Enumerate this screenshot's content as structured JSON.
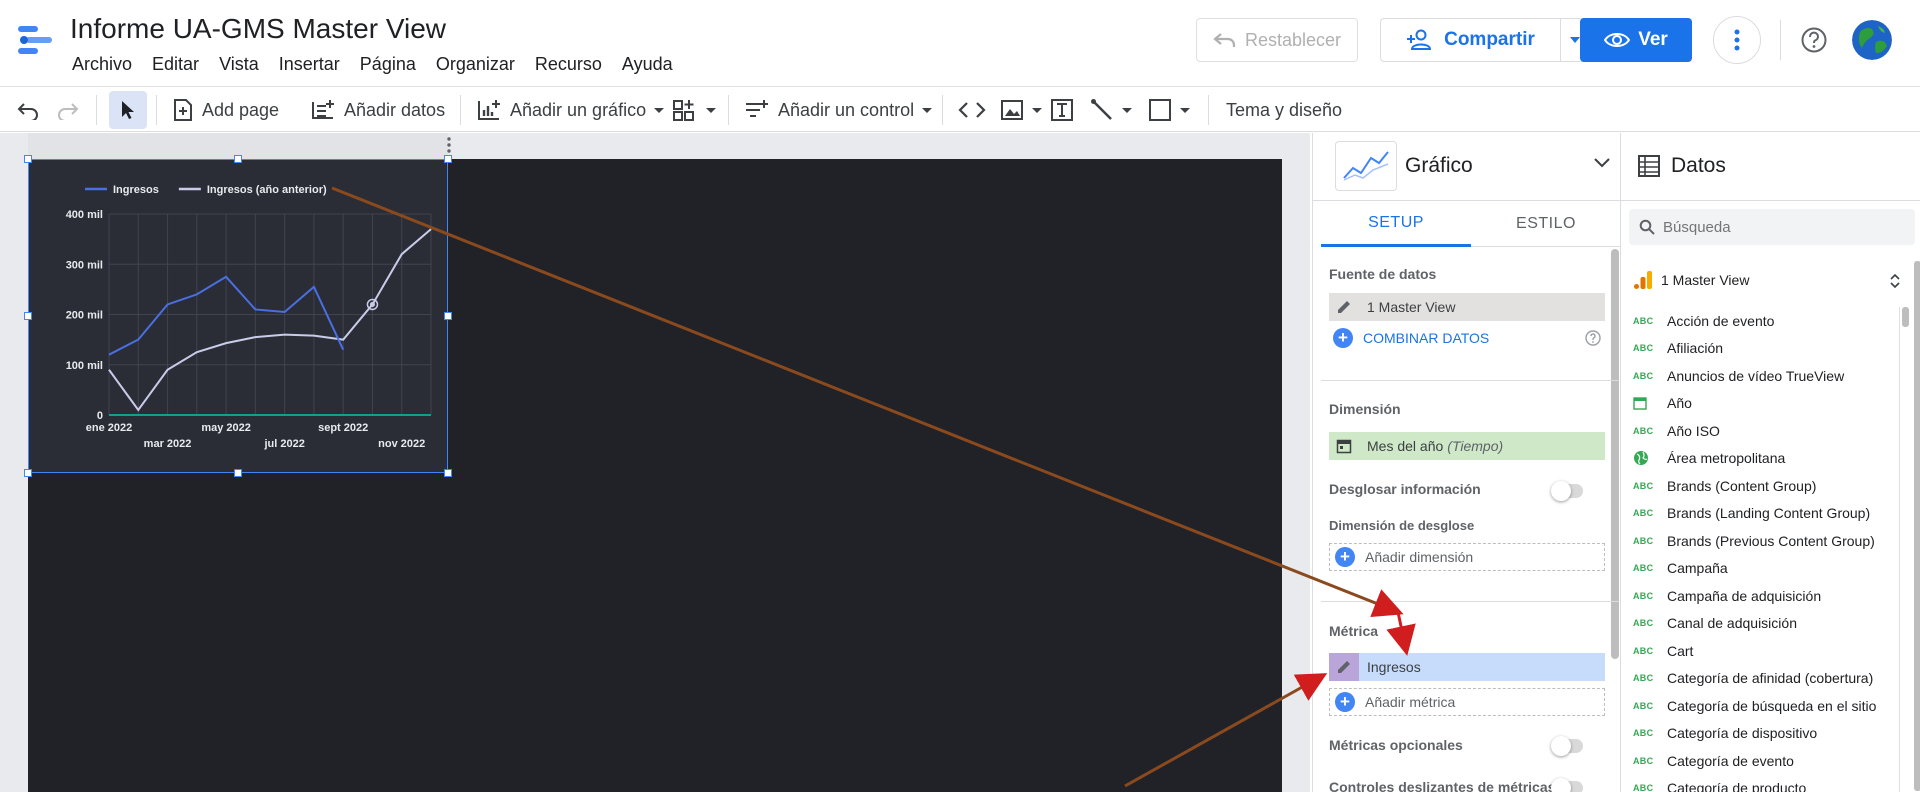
{
  "app": {
    "title": "Informe UA-GMS Master View",
    "menu": [
      "Archivo",
      "Editar",
      "Vista",
      "Insertar",
      "Página",
      "Organizar",
      "Recurso",
      "Ayuda"
    ],
    "reset_label": "Restablecer",
    "share_label": "Compartir",
    "view_label": "Ver"
  },
  "toolbar": {
    "add_page": "Add page",
    "add_data": "Añadir datos",
    "add_chart": "Añadir un gráfico",
    "add_control": "Añadir un control",
    "theme": "Tema y diseño"
  },
  "chart_data": {
    "type": "line",
    "series": [
      {
        "name": "Ingresos",
        "color": "#4a6fe3",
        "values": [
          120,
          150,
          220,
          240,
          275,
          210,
          205,
          255,
          130
        ]
      },
      {
        "name": "Ingresos (año anterior)",
        "color": "#c8cce8",
        "values": [
          90,
          10,
          90,
          125,
          143,
          155,
          160,
          158,
          150,
          220,
          320,
          370
        ]
      }
    ],
    "x_ticks_top": [
      "ene 2022",
      "may 2022",
      "sept 2022"
    ],
    "x_ticks_bottom": [
      "mar 2022",
      "jul 2022",
      "nov 2022"
    ],
    "y_ticks": [
      "0",
      "100 mil",
      "200 mil",
      "300 mil",
      "400 mil"
    ],
    "ylim": [
      0,
      400
    ]
  },
  "properties": {
    "chart_type": "Gráfico",
    "tabs": [
      "SETUP",
      "ESTILO"
    ],
    "data_source_label": "Fuente de datos",
    "data_source": "1 Master View",
    "blend_data": "COMBINAR DATOS",
    "dimension_label": "Dimensión",
    "dimension_field": "Mes del año",
    "dimension_type": "(Tiempo)",
    "drilldown_label": "Desglosar información",
    "breakdown_label": "Dimensión de desglose",
    "add_dimension": "Añadir dimensión",
    "metric_label": "Métrica",
    "metric_field": "Ingresos",
    "add_metric": "Añadir métrica",
    "optional_metrics_label": "Métricas opcionales",
    "metric_sliders_label": "Controles deslizantes de métricas"
  },
  "data_panel": {
    "title": "Datos",
    "search_placeholder": "Búsqueda",
    "source": "1 Master View",
    "fields": [
      {
        "name": "Acción de evento",
        "icon": "abc"
      },
      {
        "name": "Afiliación",
        "icon": "abc"
      },
      {
        "name": "Anuncios de vídeo TrueView",
        "icon": "abc"
      },
      {
        "name": "Año",
        "icon": "calendar"
      },
      {
        "name": "Año ISO",
        "icon": "abc"
      },
      {
        "name": "Área metropolitana",
        "icon": "globe"
      },
      {
        "name": "Brands (Content Group)",
        "icon": "abc"
      },
      {
        "name": "Brands (Landing Content Group)",
        "icon": "abc"
      },
      {
        "name": "Brands (Previous Content Group)",
        "icon": "abc"
      },
      {
        "name": "Campaña",
        "icon": "abc"
      },
      {
        "name": "Campaña de adquisición",
        "icon": "abc"
      },
      {
        "name": "Canal de adquisición",
        "icon": "abc"
      },
      {
        "name": "Cart",
        "icon": "abc"
      },
      {
        "name": "Categoría de afinidad (cobertura)",
        "icon": "abc"
      },
      {
        "name": "Categoría de búsqueda en el sitio",
        "icon": "abc"
      },
      {
        "name": "Categoría de dispositivo",
        "icon": "abc"
      },
      {
        "name": "Categoría de evento",
        "icon": "abc"
      },
      {
        "name": "Categoría de producto",
        "icon": "abc"
      }
    ]
  }
}
